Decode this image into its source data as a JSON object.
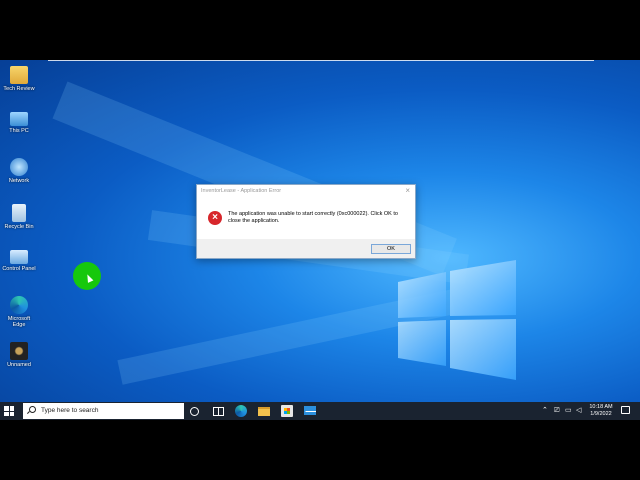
{
  "desktop": {
    "icons": [
      {
        "label": "Tech Review",
        "icon": "user-folder-icon"
      },
      {
        "label": "This PC",
        "icon": "computer-icon"
      },
      {
        "label": "Network",
        "icon": "network-icon"
      },
      {
        "label": "Recycle Bin",
        "icon": "recycle-bin-icon"
      },
      {
        "label": "Control Panel",
        "icon": "control-panel-icon"
      },
      {
        "label": "Microsoft Edge",
        "icon": "edge-icon"
      },
      {
        "label": "Unnamed",
        "icon": "app-icon"
      }
    ]
  },
  "dialog": {
    "title": "InventorLease - Application Error",
    "message": "The application was unable to start correctly (0xc000022). Click OK to close the application.",
    "ok_label": "OK",
    "close_glyph": "×",
    "icon": "error-icon",
    "error_glyph": "×"
  },
  "taskbar": {
    "search_placeholder": "Type here to search",
    "tray_icons": [
      "chevron-up-icon",
      "network-icon",
      "battery-icon",
      "volume-icon"
    ],
    "time": "10:18 AM",
    "date": "1/9/2022"
  },
  "colors": {
    "taskbar": "#1a2330",
    "error": "#d7262b",
    "cursor_highlight": "#16c80c"
  }
}
